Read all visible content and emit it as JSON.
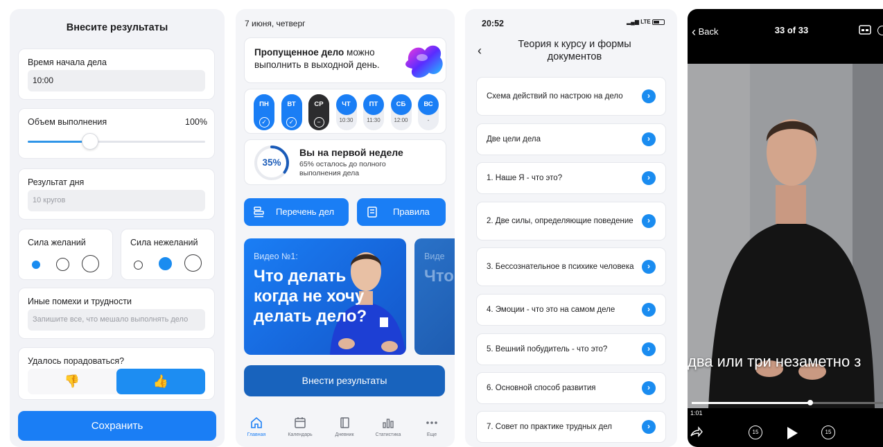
{
  "form": {
    "title": "Внесите результаты",
    "start_time_label": "Время начала дела",
    "start_time_value": "10:00",
    "volume_label": "Объем выполнения",
    "volume_value": "100%",
    "volume_slider_level": 0.35,
    "result_label": "Результат дня",
    "result_placeholder": "10 кругов",
    "desire_label": "Сила желаний",
    "undesire_label": "Сила нежеланий",
    "obstacles_label": "Иные помехи и трудности",
    "obstacles_placeholder": "Запишите все, что мешало выполнять дело",
    "joy_label": "Удалось порадоваться?",
    "thumbs_down": "👎",
    "thumbs_up": "👍",
    "save_label": "Сохранить"
  },
  "home": {
    "date": "7 июня, четверг",
    "banner_bold": "Пропущенное дело",
    "banner_rest": " можно выполнить в выходной день.",
    "days": [
      {
        "short": "ПН",
        "sub": "✓",
        "state": "done"
      },
      {
        "short": "ВТ",
        "sub": "✓",
        "state": "done"
      },
      {
        "short": "СР",
        "sub": "−",
        "state": "missed"
      },
      {
        "short": "ЧТ",
        "sub": "10:30",
        "state": "planned"
      },
      {
        "short": "ПТ",
        "sub": "11:30",
        "state": "planned"
      },
      {
        "short": "СБ",
        "sub": "12:00",
        "state": "planned"
      },
      {
        "short": "ВС",
        "sub": "-",
        "state": "planned"
      }
    ],
    "progress_pct": "35%",
    "progress_value": 0.35,
    "progress_title": "Вы на первой неделе",
    "progress_sub": "65% осталось до полного выполнения дела",
    "list_button": "Перечень дел",
    "rules_button": "Правила",
    "video_sub": "Видео №1:",
    "video_title": "Что делать когда не хочу делать дело?",
    "video2_sub": "Виде",
    "video2_title": "Что ког дел",
    "enter_results": "Внести результаты",
    "tabs": [
      {
        "label": "Главная",
        "icon": "home-icon"
      },
      {
        "label": "Календарь",
        "icon": "calendar-icon"
      },
      {
        "label": "Дневник",
        "icon": "book-icon"
      },
      {
        "label": "Статистика",
        "icon": "stats-icon"
      },
      {
        "label": "Еще",
        "icon": "more-icon"
      }
    ]
  },
  "docs": {
    "time": "20:52",
    "network": "LTE",
    "title": "Теория к курсу и формы документов",
    "items": [
      "Схема действий по настрою на дело",
      "Две цели дела",
      "1. Наше Я - что это?",
      "2. Две силы, определяющие поведение",
      "3. Бессознательное в психике человека",
      "4. Эмоции - что это на самом деле",
      "5. Вешний побудитель - что это?",
      "6. Основной способ развития",
      "7. Совет по практике трудных дел"
    ]
  },
  "player": {
    "back": "Back",
    "counter": "33 of 33",
    "subtitle": "два или три незаметно з",
    "time": "1:01",
    "position": 0.62,
    "skip_back": "15",
    "skip_fwd": "15"
  },
  "colors": {
    "accent": "#1a7ef5",
    "accent_dark": "#1863bd",
    "background": "#f2f3f7"
  }
}
